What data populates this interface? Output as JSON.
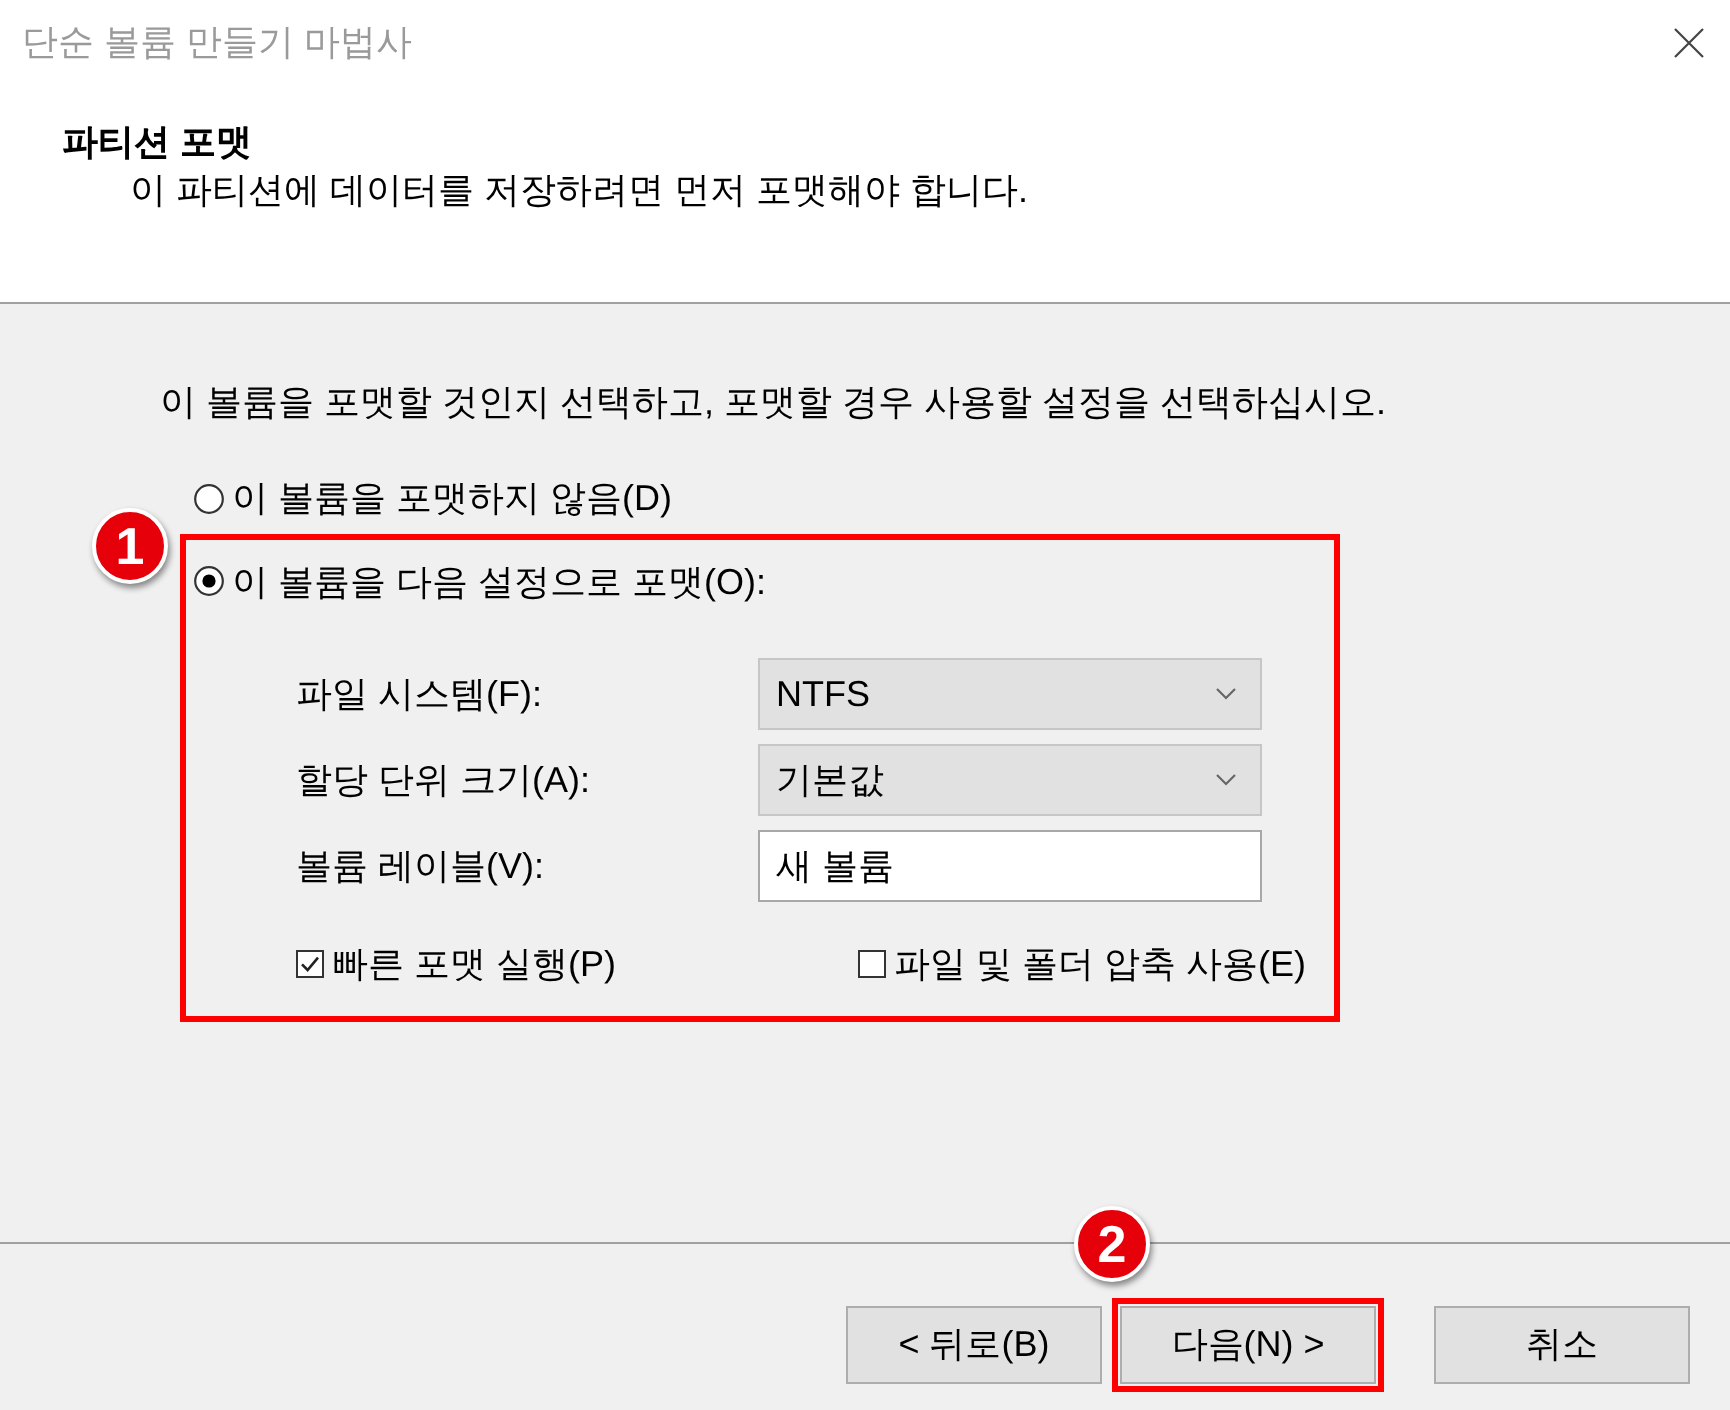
{
  "window": {
    "title": "단순 볼륨 만들기 마법사"
  },
  "header": {
    "heading": "파티션 포맷",
    "subtitle": "이 파티션에 데이터를 저장하려면 먼저 포맷해야 합니다."
  },
  "intro": "이 볼륨을 포맷할 것인지 선택하고, 포맷할 경우 사용할 설정을 선택하십시오.",
  "options": [
    {
      "label": "이 볼륨을 포맷하지 않음(D)",
      "selected": false,
      "highlighted": false
    },
    {
      "label": "이 볼륨을 다음 설정으로 포맷(O):",
      "selected": true,
      "highlighted": true,
      "callout": "1",
      "settings": {
        "fields": [
          {
            "kind": "dropdown",
            "label": "파일 시스템(F):",
            "value": "NTFS"
          },
          {
            "kind": "dropdown",
            "label": "할당 단위 크기(A):",
            "value": "기본값"
          },
          {
            "kind": "text",
            "label": "볼륨 레이블(V):",
            "value": "새 볼륨"
          }
        ],
        "checkboxes": [
          {
            "label": "빠른 포맷 실행(P)",
            "checked": true
          },
          {
            "label": "파일 및 폴더 압축 사용(E)",
            "checked": false
          }
        ]
      }
    }
  ],
  "buttons": [
    {
      "label": "< 뒤로(B)",
      "highlighted": false
    },
    {
      "label": "다음(N) >",
      "highlighted": true,
      "callout": "2"
    },
    {
      "label": "취소",
      "highlighted": false
    }
  ]
}
